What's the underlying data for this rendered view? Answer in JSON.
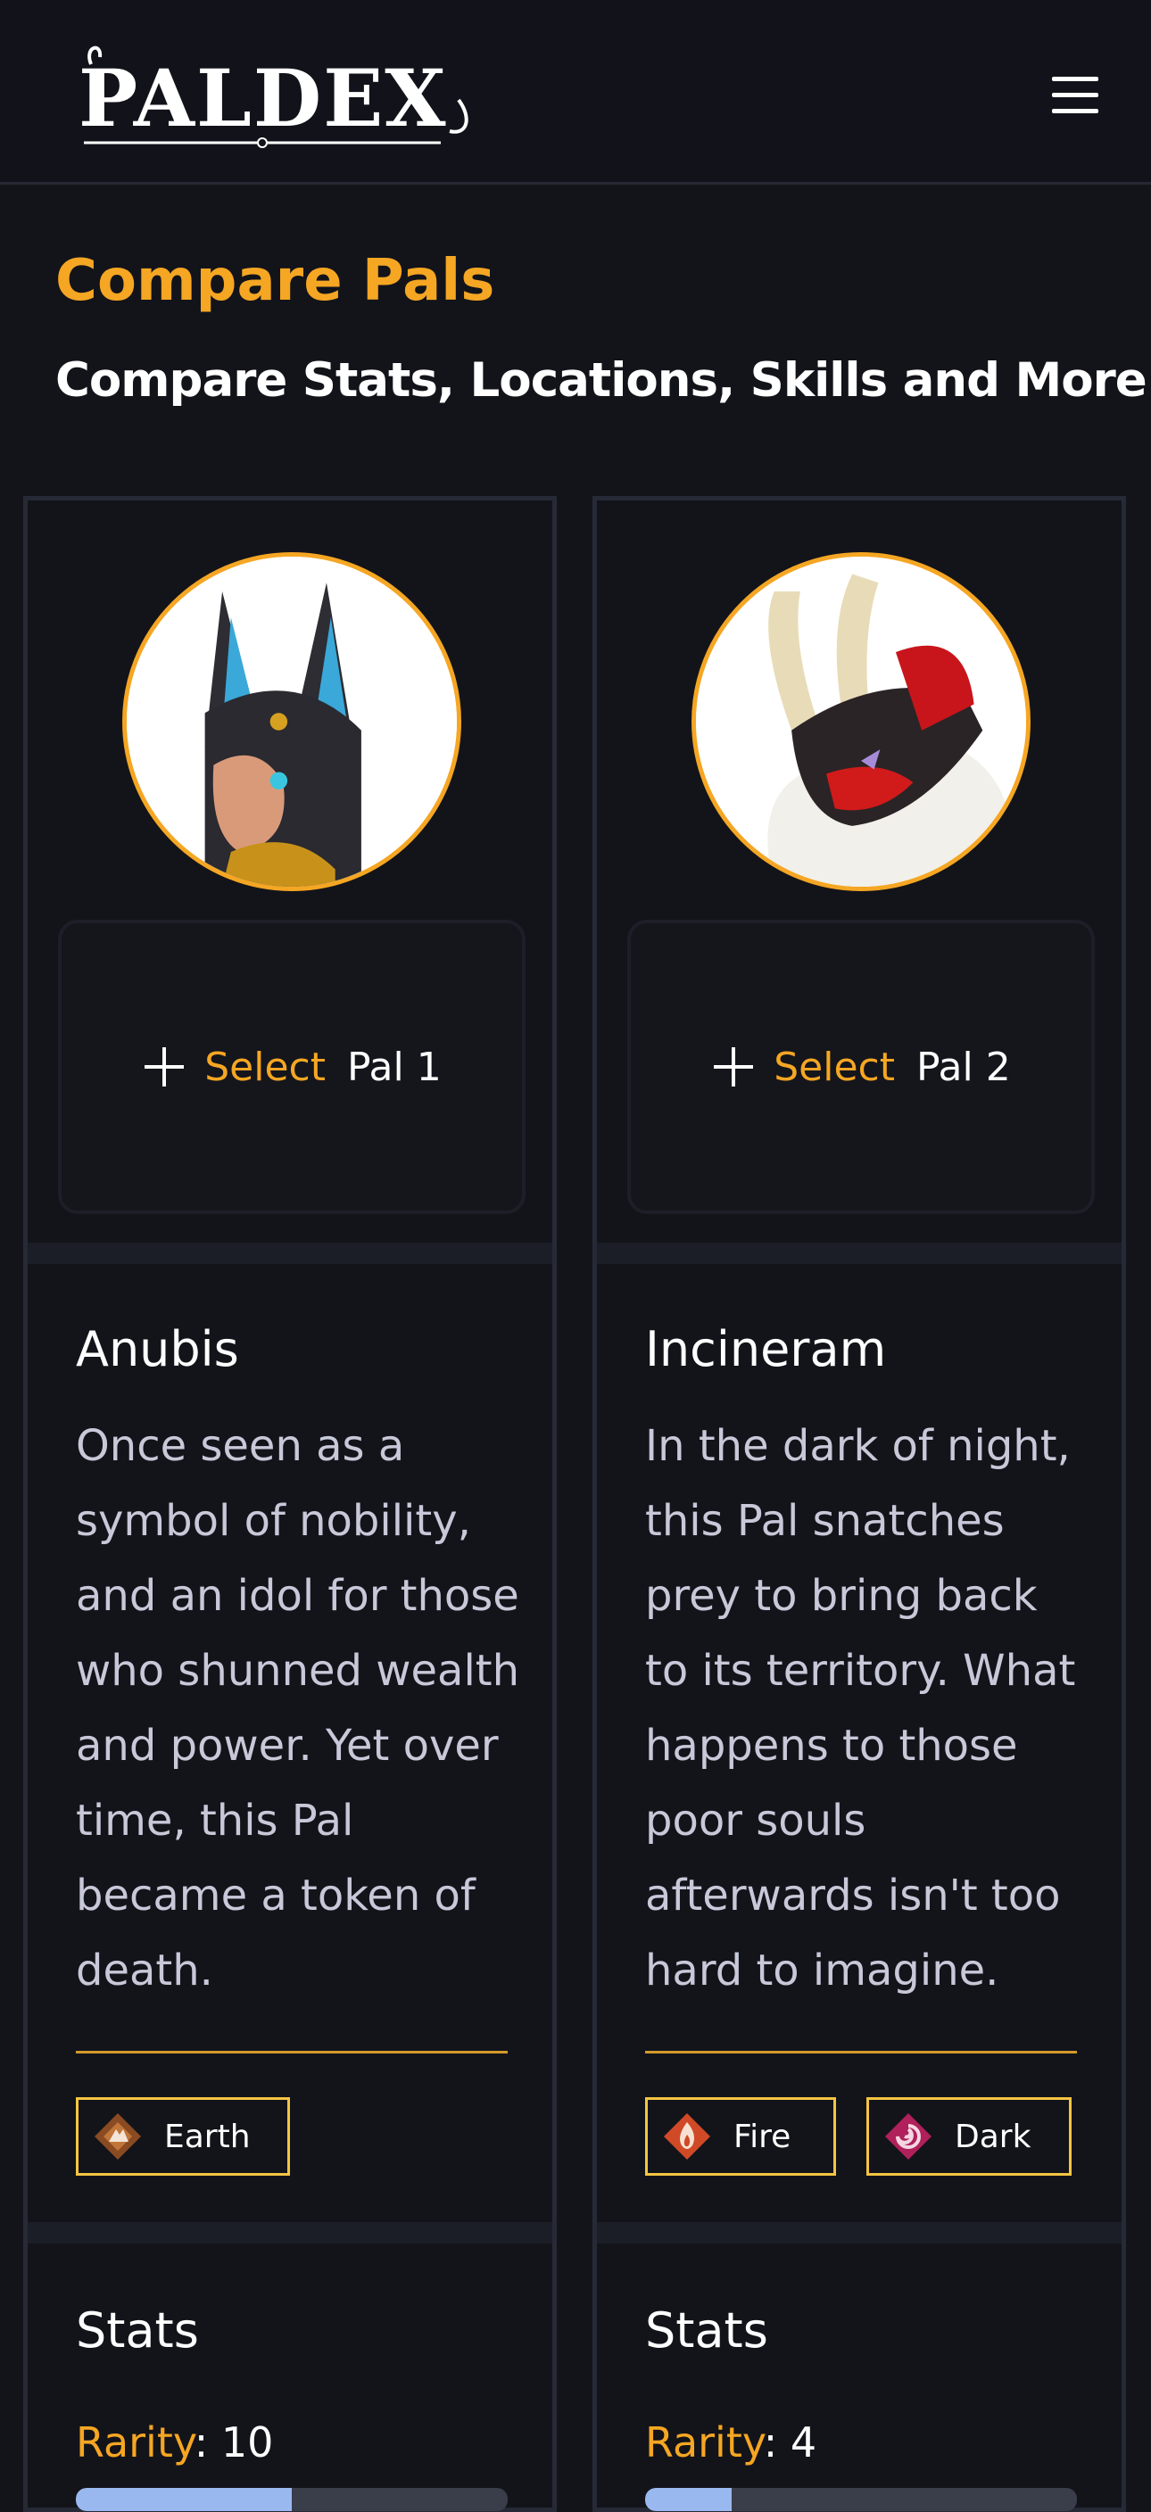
{
  "header": {
    "logo_text": "PALDEX",
    "menu_icon": "hamburger-menu-icon"
  },
  "page": {
    "title": "Compare Pals",
    "subtitle": "Compare Stats, Locations, Skills and More!"
  },
  "colors": {
    "accent": "#f5a623",
    "background": "#13141a",
    "card_border": "#262a36",
    "type_border": "#f5c542",
    "bar_fill": "#9ab8f0",
    "bar_track": "#3a3d4a"
  },
  "pals": [
    {
      "select_word": "Select",
      "slot_label": "Pal 1",
      "name": "Anubis",
      "description": "Once seen as a symbol of nobility, and an idol for those who shunned wealth and power. Yet over time, this Pal became a token of death.",
      "types": [
        {
          "label": "Earth",
          "icon": "earth-element-icon",
          "color": "#8a4a22"
        }
      ],
      "stats_title": "Stats",
      "rarity_label": "Rarity",
      "rarity_value": "10",
      "rarity_fraction": 0.5
    },
    {
      "select_word": "Select",
      "slot_label": "Pal 2",
      "name": "Incineram",
      "description": "In the dark of night, this Pal snatches prey to bring back to its territory. What happens to those poor souls afterwards isn't too hard to imagine.",
      "types": [
        {
          "label": "Fire",
          "icon": "fire-element-icon",
          "color": "#d04a28"
        },
        {
          "label": "Dark",
          "icon": "dark-element-icon",
          "color": "#b0205a"
        }
      ],
      "stats_title": "Stats",
      "rarity_label": "Rarity",
      "rarity_value": "4",
      "rarity_fraction": 0.2
    }
  ]
}
